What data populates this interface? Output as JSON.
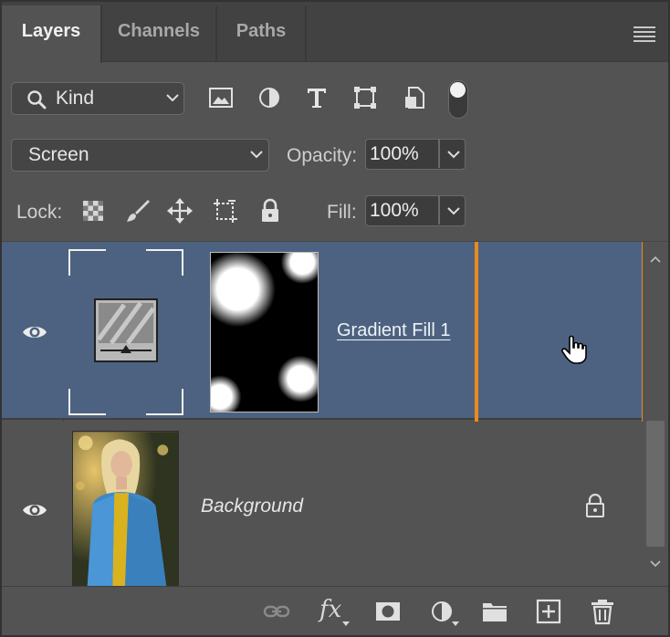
{
  "tabs": [
    {
      "label": "Layers",
      "active": true
    },
    {
      "label": "Channels",
      "active": false
    },
    {
      "label": "Paths",
      "active": false
    }
  ],
  "filter": {
    "kind_label": "Kind",
    "icons": [
      "image-filter-icon",
      "adjustment-filter-icon",
      "type-filter-icon",
      "shape-filter-icon",
      "smart-object-filter-icon"
    ],
    "toggle_on": true
  },
  "blend": {
    "mode": "Screen",
    "opacity_label": "Opacity:",
    "opacity_value": "100%"
  },
  "lock": {
    "label": "Lock:",
    "fill_label": "Fill:",
    "fill_value": "100%"
  },
  "layers": [
    {
      "name": "Gradient Fill 1",
      "selected": true,
      "visible": true,
      "type": "gradient-fill"
    },
    {
      "name": "Background",
      "selected": false,
      "visible": true,
      "locked": true,
      "type": "pixel"
    }
  ],
  "bottom_toolbar": {
    "fx_label": "fx",
    "icons": [
      "link-layers-icon",
      "layer-style-icon",
      "layer-mask-icon",
      "adjustment-layer-icon",
      "group-folder-icon",
      "new-layer-icon",
      "delete-layer-icon"
    ]
  },
  "colors": {
    "selected_row": "#4d6280",
    "highlight": "#e88a1e",
    "panel_bg": "#535353"
  }
}
